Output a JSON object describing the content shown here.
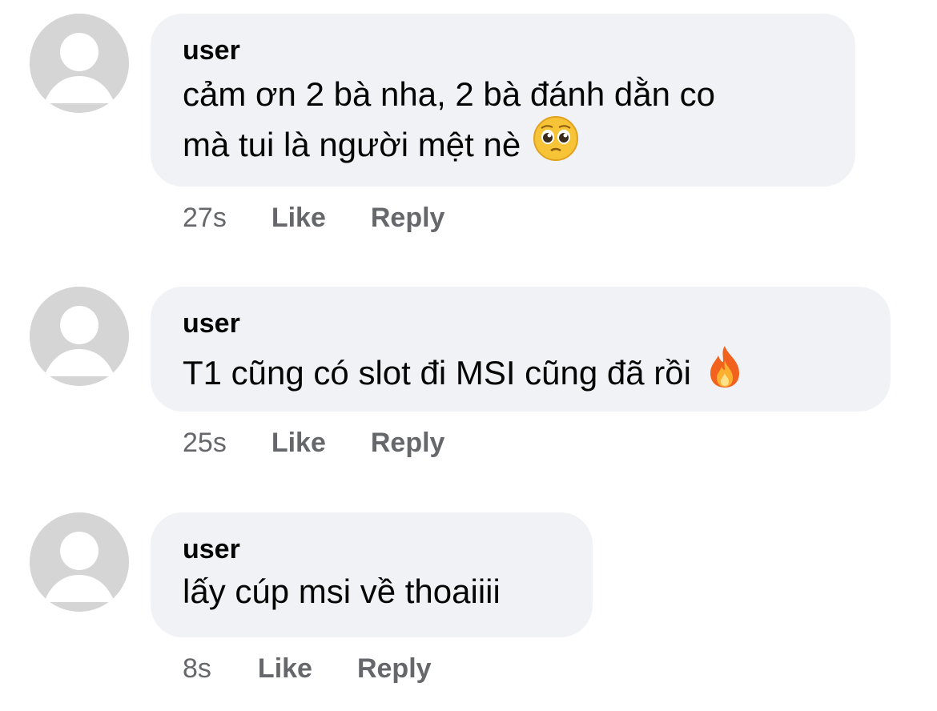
{
  "comments": [
    {
      "author": "user",
      "text_line1": "cảm ơn 2 bà nha, 2 bà đánh dằn co",
      "text_line2": "mà tui là người mệt nè",
      "emoji": "pleading-face-emoji",
      "time": "27s",
      "like_label": "Like",
      "reply_label": "Reply"
    },
    {
      "author": "user",
      "text_line1": "T1 cũng có slot đi MSI cũng đã rồi",
      "emoji": "fire-emoji",
      "time": "25s",
      "like_label": "Like",
      "reply_label": "Reply"
    },
    {
      "author": "user",
      "text_line1": "lấy cúp msi về thoaiiii",
      "time": "8s",
      "like_label": "Like",
      "reply_label": "Reply"
    }
  ],
  "colors": {
    "bubble": "#f0f2f5",
    "meta_text": "#65676b",
    "avatar_bg": "#d5d5d5",
    "avatar_fg": "#ffffff"
  }
}
